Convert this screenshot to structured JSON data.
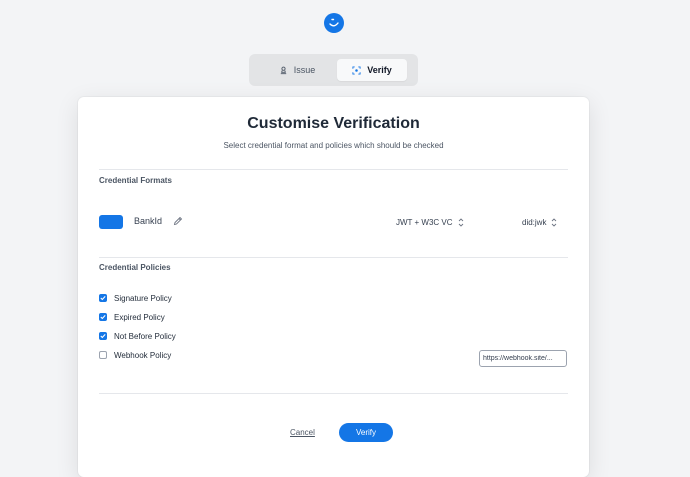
{
  "brand": {
    "accent": "#1476e6"
  },
  "tabs": {
    "issue_label": "Issue",
    "verify_label": "Verify",
    "active": "Verify"
  },
  "main": {
    "title": "Customise Verification",
    "subtitle": "Select credential format and policies which should be checked"
  },
  "formats": {
    "section_label": "Credential Formats",
    "item_name": "BankId",
    "format_select": "JWT + W3C VC",
    "did_select": "did:jwk"
  },
  "policies": {
    "section_label": "Credential Policies",
    "items": [
      {
        "label": "Signature Policy",
        "checked": true
      },
      {
        "label": "Expired Policy",
        "checked": true
      },
      {
        "label": "Not Before Policy",
        "checked": true
      },
      {
        "label": "Webhook Policy",
        "checked": false
      }
    ],
    "webhook_value": "https://webhook.site/..."
  },
  "actions": {
    "cancel_label": "Cancel",
    "verify_label": "Verify"
  }
}
